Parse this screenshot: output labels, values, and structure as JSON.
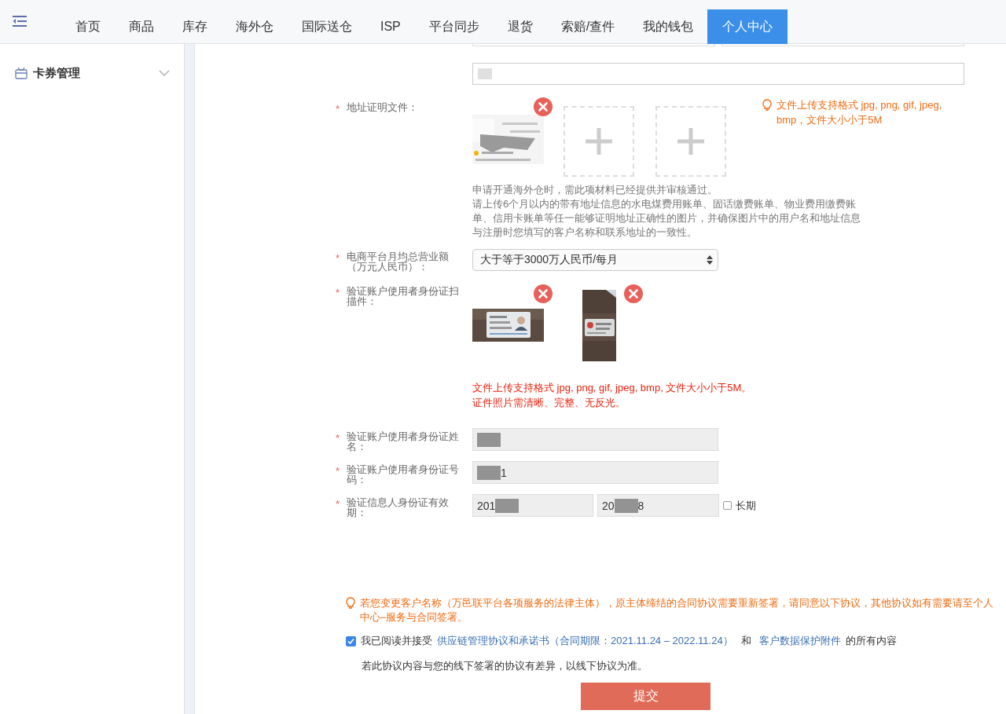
{
  "nav": {
    "tabs": [
      {
        "label": "首页",
        "selected": false
      },
      {
        "label": "商品",
        "selected": false
      },
      {
        "label": "库存",
        "selected": false
      },
      {
        "label": "海外仓",
        "selected": false
      },
      {
        "label": "国际送仓",
        "selected": false
      },
      {
        "label": "ISP",
        "selected": false
      },
      {
        "label": "平台同步",
        "selected": false
      },
      {
        "label": "退货",
        "selected": false
      },
      {
        "label": "索赔/查件",
        "selected": false
      },
      {
        "label": "我的钱包",
        "selected": false
      },
      {
        "label": "个人中心",
        "selected": true
      }
    ]
  },
  "sidebar": {
    "items": [
      {
        "label": "卡券管理",
        "expanded": false
      }
    ]
  },
  "form": {
    "address_proof": {
      "label": "地址证明文件：",
      "mark": "*",
      "uploads": [
        {
          "kind": "picture"
        },
        {
          "kind": "empty"
        },
        {
          "kind": "empty"
        }
      ],
      "tip": "文件上传支持格式 jpg, png, gif, jpeg, bmp，文件大小小于5M",
      "help": [
        "申请开通海外仓时，需此项材料已经提供并审核通过。",
        "请上传6个月以内的带有地址信息的水电煤费用账单、固话缴费账单、物业费用缴费账单、信用卡账单等任一能够证明地址正确性的图片，并确保图片中的用户名和地址信息与注册时您填写的客户名称和联系地址的一致性。"
      ]
    },
    "revenue": {
      "label": "电商平台月均总营业额（万元人民币）：",
      "mark": "*",
      "value": "大于等于3000万人民币/每月"
    },
    "id_scan": {
      "label": "验证账户使用者身份证扫描件：",
      "mark": "*",
      "uploads": [
        {
          "kind": "card_front"
        },
        {
          "kind": "card_back"
        }
      ],
      "notes": [
        "文件上传支持格式 jpg, png, gif, jpeg, bmp, 文件大小小于5M。",
        "证件照片需清晰、完整、无反光。"
      ]
    },
    "id_name": {
      "label": "验证账户使用者身份证姓名：",
      "mark": "*",
      "parts": [
        {
          "kind": "redacted"
        }
      ]
    },
    "id_number": {
      "label": "验证账户使用者身份证号码：",
      "mark": "*",
      "parts": [
        {
          "kind": "redacted"
        },
        {
          "kind": "text",
          "text": "1"
        }
      ]
    },
    "validity": {
      "label": "验证信息人身份证有效期：",
      "mark": "*",
      "start": [
        {
          "kind": "text",
          "text": "201"
        },
        {
          "kind": "redacted"
        }
      ],
      "end": [
        {
          "kind": "text",
          "text": "20"
        },
        {
          "kind": "redacted"
        },
        {
          "kind": "text",
          "text": "8"
        }
      ],
      "long_term": {
        "label": "长期",
        "checked": false
      }
    }
  },
  "notice": "若您变更客户名称（万邑联平台各项服务的法律主体），原主体缔结的合同协议需要重新签署，请同意以下协议，其他协议如有需要请至个人中心–服务与合同签署。",
  "agreement": {
    "checked": true,
    "prefix": "我已阅读并接受",
    "link1": "供应链管理协议和承诺书（合同期限：2021.11.24 – 2022.11.24）",
    "middle": "和",
    "link2": "客户数据保护附件",
    "suffix": "的所有内容"
  },
  "offline_note": "若此协议内容与您的线下签署的协议有差异，以线下协议为准。",
  "submit": "提交"
}
